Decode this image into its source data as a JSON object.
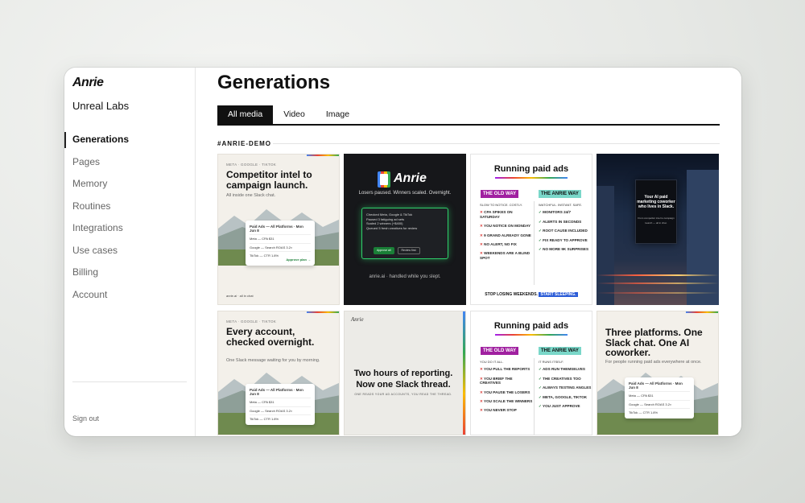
{
  "app": {
    "logo": "Anrie",
    "org": "Unreal Labs",
    "sign_out": "Sign out"
  },
  "nav": [
    {
      "label": "Generations",
      "active": true
    },
    {
      "label": "Pages"
    },
    {
      "label": "Memory"
    },
    {
      "label": "Routines"
    },
    {
      "label": "Integrations"
    },
    {
      "label": "Use cases"
    },
    {
      "label": "Billing"
    },
    {
      "label": "Account"
    }
  ],
  "page": {
    "title": "Generations",
    "section": "#ANRIE-DEMO"
  },
  "tabs": [
    {
      "label": "All media",
      "active": true
    },
    {
      "label": "Video"
    },
    {
      "label": "Image"
    }
  ],
  "cards": {
    "c1": {
      "kicker": "META · GOOGLE · TIKTOK",
      "headline": "Competitor intel to campaign launch.",
      "sub": "All inside one Slack chat.",
      "slack_title": "Paid Ads — All Platforms · Mon Jun 8",
      "rows": [
        "Meta — CPA $31",
        "Google — Search ROAS 3.2×",
        "TikTok — CTR 1.8%"
      ],
      "action": "Approve plan →",
      "foot": "anrie.ai · all in chat"
    },
    "c2": {
      "brand": "Anrie",
      "tagline": "Losers paused. Winners scaled. Overnight.",
      "msg_lines": [
        "Checked Meta, Google & TikTok",
        "Paused 3 fatiguing ad sets",
        "Scaled 2 winners (+$400)",
        "Queued 5 fresh creatives for review"
      ],
      "approve": "Approve all",
      "review": "Review first",
      "foot": "anrie.ai · handled while you slept."
    },
    "c3": {
      "title": "Running paid ads",
      "old_label": "THE OLD WAY",
      "new_label": "THE ANRIE WAY",
      "old_head": "SLOW TO NOTICE. COSTLY.",
      "new_head": "WATCHFUL. INSTANT. SAFE.",
      "old_items": [
        "CPA SPIKES ON SATURDAY",
        "YOU NOTICE ON MONDAY",
        "9 GRAND ALREADY GONE",
        "NO ALERT, NO FIX",
        "WEEKENDS ARE A BLIND SPOT"
      ],
      "new_items": [
        "MONITORS 24/7",
        "ALERTS IN SECONDS",
        "ROOT CAUSE INCLUDED",
        "FIX READY TO APPROVE",
        "NO MORE 9K SURPRISES"
      ],
      "foot_a": "STOP LOSING WEEKENDS.",
      "foot_b": "START SLEEPING."
    },
    "c4": {
      "billboard": "Your AI paid marketing coworker who lives in Slack.",
      "billboard_small": "From competitor intel to campaign launch — all in chat."
    },
    "c5": {
      "kicker": "META · GOOGLE · TIKTOK",
      "headline": "Every account, checked overnight.",
      "sub": "One Slack message waiting for you by morning.",
      "slack_title": "Paid Ads — All Platforms · Mon Jun 8",
      "rows": [
        "Meta — CPA $31",
        "Google — Search ROAS 3.2×",
        "TikTok — CTR 1.8%"
      ]
    },
    "c6": {
      "logo": "Anrie",
      "headline": "Two hours of reporting. Now one Slack thread.",
      "sub": "ONE READS YOUR AD ACCOUNTS, YOU READ THE THREAD."
    },
    "c7": {
      "title": "Running paid ads",
      "old_label": "THE OLD WAY",
      "new_label": "THE ANRIE WAY",
      "old_head": "YOU DO IT ALL.",
      "new_head": "IT RUNS ITSELF.",
      "old_items": [
        "YOU PULL THE REPORTS",
        "YOU BRIEF THE CREATIVES",
        "YOU PAUSE THE LOSERS",
        "YOU SCALE THE WINNERS",
        "YOU NEVER STOP"
      ],
      "new_items": [
        "ADS RUN THEMSELVES",
        "THE CREATIVES TOO",
        "ALWAYS TESTING ANGLES",
        "META, GOOGLE, TIKTOK",
        "YOU JUST APPROVE"
      ]
    },
    "c8": {
      "headline": "Three platforms. One Slack chat. One AI coworker.",
      "sub": "For people running paid ads everywhere at once.",
      "slack_title": "Paid Ads — All Platforms · Mon Jun 8",
      "rows": [
        "Meta — CPA $31",
        "Google — Search ROAS 3.2×",
        "TikTok — CTR 1.8%"
      ]
    }
  }
}
